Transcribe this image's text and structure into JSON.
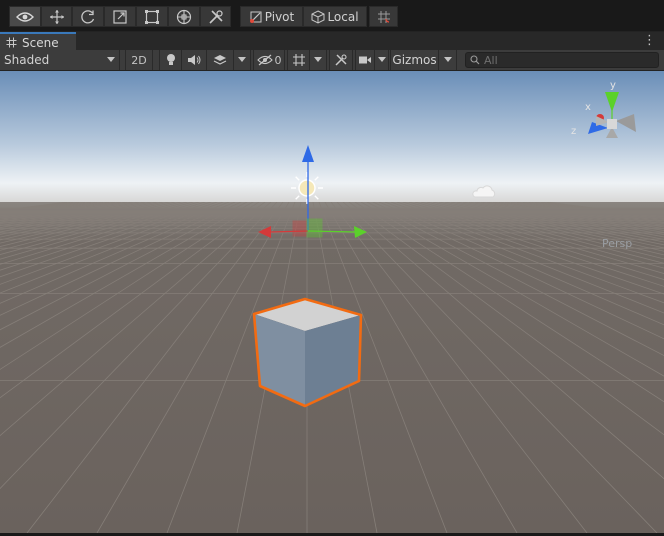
{
  "toolbar": {
    "tools": [
      {
        "name": "view-tool",
        "icon": "eye-icon",
        "active": true
      },
      {
        "name": "move-tool",
        "icon": "move-arrows-icon"
      },
      {
        "name": "rotate-tool",
        "icon": "rotate-icon"
      },
      {
        "name": "scale-tool",
        "icon": "scale-icon"
      },
      {
        "name": "rect-tool",
        "icon": "rect-transform-icon"
      },
      {
        "name": "transform-tool",
        "icon": "transform-icon"
      },
      {
        "name": "custom-tool",
        "icon": "tools-icon"
      }
    ],
    "pivot_label": "Pivot",
    "local_label": "Local",
    "snap_icon": "grid-snap-icon"
  },
  "tab": {
    "label": "Scene",
    "icon": "grid-icon"
  },
  "scene_toolbar": {
    "draw_mode": "Shaded",
    "mode_2d": "2D",
    "hidden_count": "0",
    "gizmos_label": "Gizmos",
    "search_placeholder": "All"
  },
  "viewport": {
    "projection_label": "Persp",
    "axes": {
      "x": "x",
      "y": "y",
      "z": "z"
    },
    "colors": {
      "selection_outline": "#f26b12",
      "x_axis": "#d43a3a",
      "y_axis": "#5bd12a",
      "z_axis": "#2f6ae6",
      "ground": "#6f6863",
      "sky_top": "#6c8fb8"
    }
  }
}
